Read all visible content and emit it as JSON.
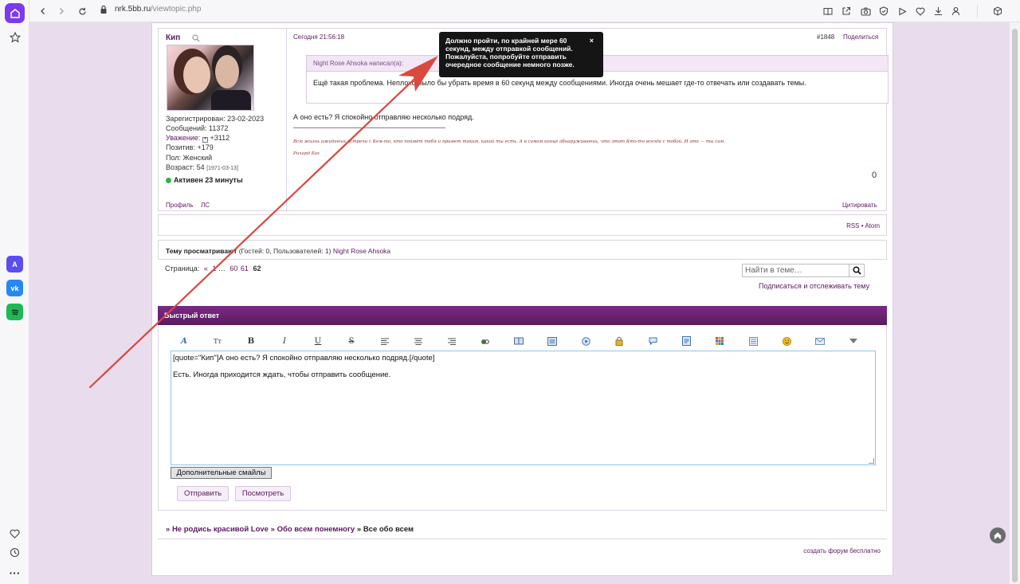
{
  "browser": {
    "url_host": "nrk.5bb.ru",
    "url_path": "/viewtopic.php",
    "icons": [
      "back-icon",
      "forward-icon",
      "reload-icon",
      "lock-icon",
      "reader-icon",
      "share-icon",
      "camera-icon",
      "shield-icon",
      "play-icon",
      "heart-icon",
      "download-icon",
      "profile-icon",
      "extensions-icon"
    ],
    "sidebar_apps": [
      "aria-app",
      "vk-app",
      "spotify-app"
    ]
  },
  "post": {
    "author": "Кип",
    "registered": "Зарегистрирован: 23-02-2023",
    "messages": "Сообщений: 11372",
    "respect_label": "Уважение:",
    "respect_value": "+3112",
    "positive": "Позитив: +179",
    "gender": "Пол: Женский",
    "age_label": "Возраст: 54",
    "age_date": "[1971-03-13]",
    "activity": "Активен 23 минуты",
    "profile_link": "Профиль",
    "pm_link": "ЛС",
    "date": "Сегодня 21:56:18",
    "number": "#1848",
    "share": "Поделиться",
    "quote_author": "Night Rose Ahsoka написал(а):",
    "quote_text": "Ещё такая проблема. Неплохо было бы убрать время в 60 секунд между сообщениями. Иногда очень мешает где-то отвечать или создавать темы.",
    "text": "А оно есть? Я спокойно отправляю несколько подряд.",
    "signature": "Всю жизнь ожидаешь встречи с Кем-то, кто поймёт тебя и примет таким, какой ты есть. А в самом конце обнаруживаешь, что этот Кто-то всегда с тобой. И это — ты сам.",
    "signature_author": "Ричард Бах",
    "rating": "0",
    "quote_link": "Цитировать"
  },
  "rss": {
    "text": "RSS • Atom"
  },
  "viewers": {
    "label": "Тему просматривают",
    "counts": "(Гостей: 0, Пользователей: 1)",
    "user": "Night Rose Ahsoka"
  },
  "pagination": {
    "label": "Страница:",
    "prev": "«",
    "first": "1",
    "ellipsis": "…",
    "pages": [
      "60",
      "61"
    ],
    "current": "62"
  },
  "search": {
    "placeholder": "Найти в теме…"
  },
  "subscribe": "Подписаться и отслеживать тему",
  "quick_reply": {
    "title": "Быстрый ответ",
    "tools": [
      "font-icon",
      "size-icon",
      "bold-icon",
      "italic-icon",
      "underline-icon",
      "strike-icon",
      "align-left-icon",
      "align-center-icon",
      "align-right-icon",
      "link-icon",
      "book-icon",
      "image-icon",
      "video-icon",
      "lock-icon",
      "speech-icon",
      "quote-icon",
      "table-icon",
      "list-icon",
      "smile-icon",
      "mail-icon",
      "more-icon"
    ],
    "editor_line1": "[quote=\"Кип\"]А оно есть? Я спокойно отправляю несколько подряд.[/quote]",
    "editor_line2": "Есть. Иногда приходится ждать, чтобы отправить сообщение.",
    "more_smiles": "Дополнительные смайлы",
    "send": "Отправить",
    "preview": "Посмотреть"
  },
  "breadcrumbs": {
    "sep": "»",
    "forum": "Не родись красивой Love",
    "section": "Обо всем понемногу",
    "topic": "Все обо всем"
  },
  "footer": {
    "text": "создать форум бесплатно"
  },
  "toast": {
    "text": "Должно пройти, по крайней мере 60 секунд, между отправкой сообщений. Пожалуйста, попробуйте отправить очередное сообщение немного позже.",
    "close": "×"
  },
  "colors": {
    "brand": "#5b1a5f",
    "page_bg": "#e9dced",
    "arrow": "#d9493d",
    "online": "#2db34a"
  }
}
